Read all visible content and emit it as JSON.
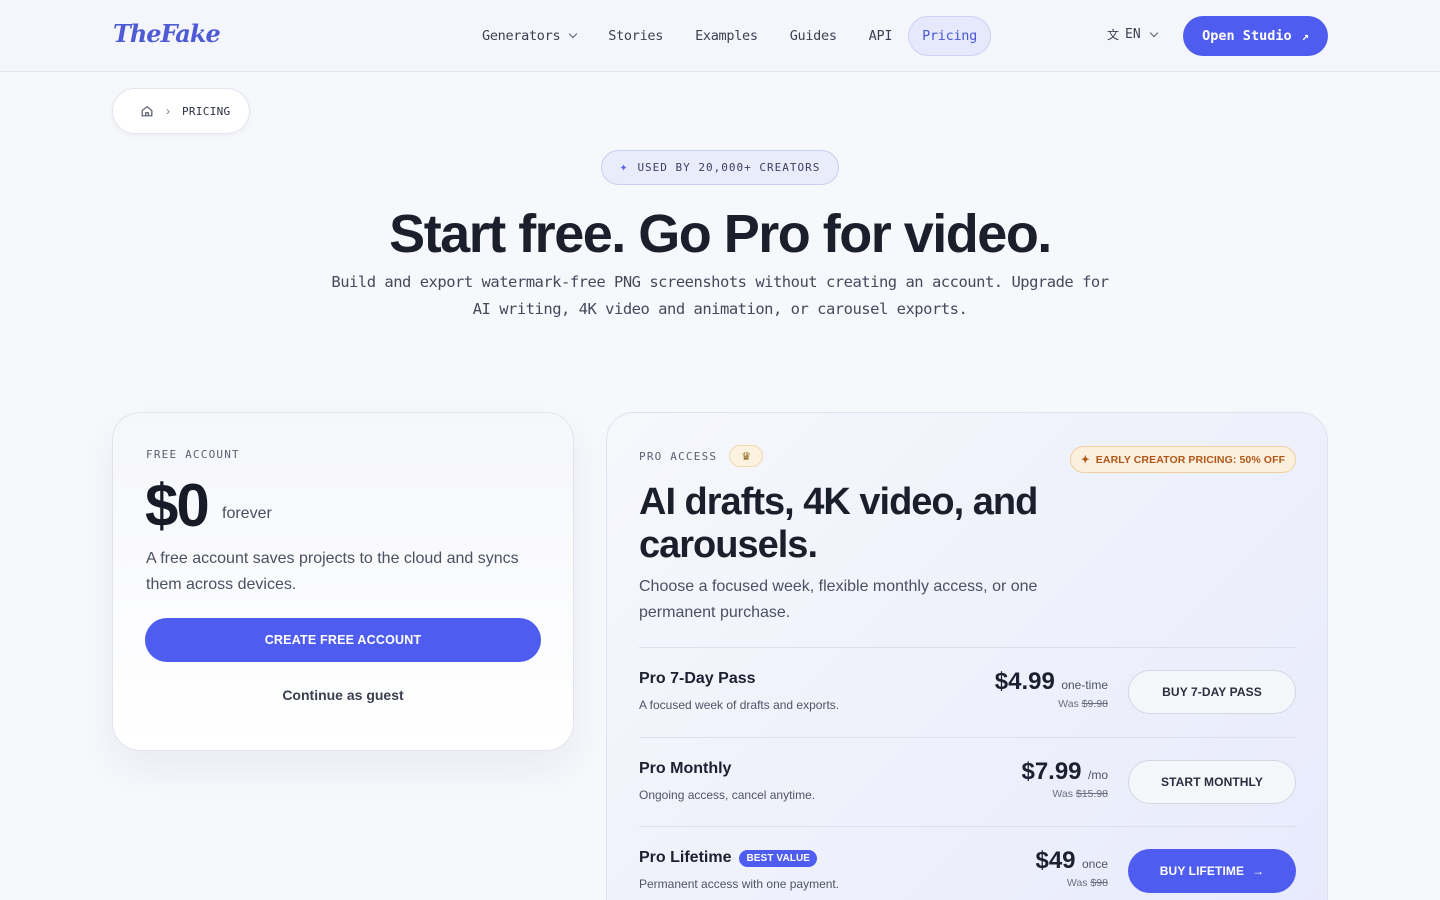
{
  "nav": {
    "logo": "TheFake",
    "links": [
      {
        "label": "Generators"
      },
      {
        "label": "Stories"
      },
      {
        "label": "Examples"
      },
      {
        "label": "Guides"
      },
      {
        "label": "API"
      },
      {
        "label": "Pricing"
      }
    ],
    "language": "EN",
    "cta": "Open Studio",
    "accent": "#4e5cf0"
  },
  "breadcrumb": {
    "current": "PRICING"
  },
  "hero": {
    "badge": "USED BY 20,000+ CREATORS",
    "title": "Start free. Go Pro for video.",
    "subtitle": "Build and export watermark-free PNG screenshots without creating an account. Upgrade for AI writing, 4K video and animation, or carousel exports."
  },
  "free": {
    "eyebrow": "FREE ACCOUNT",
    "price": "$0",
    "period": "forever",
    "description": "A free account saves projects to the cloud and syncs them across devices.",
    "button": "CREATE FREE ACCOUNT",
    "guest": "Continue as guest"
  },
  "pro": {
    "eyebrow": "PRO ACCESS",
    "promo": "EARLY CREATOR PRICING: 50% OFF",
    "title": "AI drafts, 4K video, and carousels.",
    "description": "Choose a focused week, flexible monthly access, or one permanent purchase.",
    "plans": [
      {
        "name": "Pro 7-Day Pass",
        "desc": "A focused week of drafts and exports.",
        "price": "$4.99",
        "unit": "one-time",
        "was_label": "Was",
        "was": "$9.98",
        "button": "BUY 7-DAY PASS"
      },
      {
        "name": "Pro Monthly",
        "desc": "Ongoing access, cancel anytime.",
        "price": "$7.99",
        "unit": "/mo",
        "was_label": "Was",
        "was": "$15.98",
        "button": "START MONTHLY"
      },
      {
        "name": "Pro Lifetime",
        "badge": "BEST VALUE",
        "desc": "Permanent access with one payment.",
        "price": "$49",
        "unit": "once",
        "was_label": "Was",
        "was": "$98",
        "button": "BUY LIFETIME"
      }
    ]
  }
}
